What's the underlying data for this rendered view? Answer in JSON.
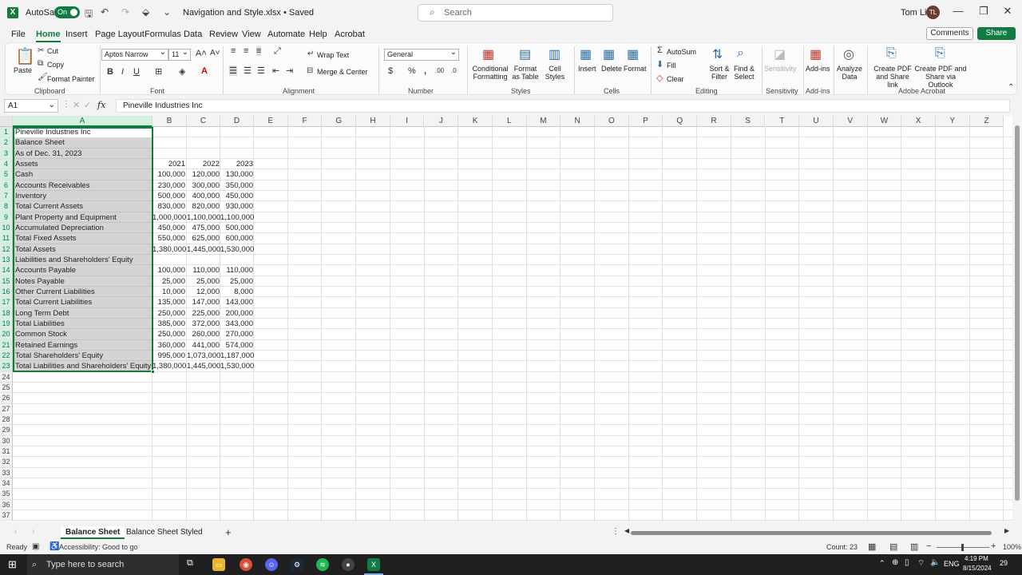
{
  "titlebar": {
    "autosave_label": "AutoSave",
    "autosave_state": "On",
    "doc_title": "Navigation and Style.xlsx • Saved",
    "search_placeholder": "Search",
    "user_name": "Tom Lin",
    "user_initials": "TL"
  },
  "tabs": [
    "File",
    "Home",
    "Insert",
    "Page Layout",
    "Formulas",
    "Data",
    "Review",
    "View",
    "Automate",
    "Help",
    "Acrobat"
  ],
  "active_tab": "Home",
  "comments_label": "Comments",
  "share_label": "Share",
  "ribbon": {
    "clipboard": {
      "paste": "Paste",
      "cut": "Cut",
      "copy": "Copy",
      "format_painter": "Format Painter",
      "label": "Clipboard"
    },
    "font": {
      "name": "Aptos Narrow",
      "size": "11",
      "label": "Font",
      "bold": "B",
      "italic": "I",
      "underline": "U"
    },
    "alignment": {
      "wrap": "Wrap Text",
      "merge": "Merge & Center",
      "label": "Alignment"
    },
    "number": {
      "format": "General",
      "label": "Number",
      "currency": "$",
      "percent": "%"
    },
    "styles": {
      "conditional": "Conditional Formatting",
      "format_table": "Format as Table",
      "cell_styles": "Cell Styles",
      "label": "Styles"
    },
    "cells": {
      "insert": "Insert",
      "delete": "Delete",
      "format": "Format",
      "label": "Cells"
    },
    "editing": {
      "autosum": "AutoSum",
      "fill": "Fill",
      "clear": "Clear",
      "sort": "Sort & Filter",
      "find": "Find & Select",
      "label": "Editing"
    },
    "sensitivity": {
      "btn": "Sensitivity",
      "label": "Sensitivity"
    },
    "addins": {
      "btn": "Add-ins",
      "label": "Add-ins"
    },
    "analyze": {
      "btn": "Analyze Data"
    },
    "acrobat": {
      "pdf_link": "Create PDF and Share link",
      "pdf_outlook": "Create PDF and Share via Outlook",
      "label": "Adobe Acrobat"
    }
  },
  "formula_bar": {
    "cell_ref": "A1",
    "fx": "fx",
    "content": "Pineville Industries Inc"
  },
  "columns": [
    "A",
    "B",
    "C",
    "D",
    "E",
    "F",
    "G",
    "H",
    "I",
    "J",
    "K",
    "L",
    "M",
    "N",
    "O",
    "P",
    "Q",
    "R",
    "S",
    "T",
    "U",
    "V",
    "W",
    "X",
    "Y",
    "Z"
  ],
  "rows": [
    {
      "a": "Pineville Industries Inc",
      "b": "",
      "c": "",
      "d": ""
    },
    {
      "a": "Balance Sheet",
      "b": "",
      "c": "",
      "d": ""
    },
    {
      "a": "As of Dec. 31, 2023",
      "b": "",
      "c": "",
      "d": ""
    },
    {
      "a": "Assets",
      "b": "2021",
      "c": "2022",
      "d": "2023"
    },
    {
      "a": "Cash",
      "b": "100,000",
      "c": "120,000",
      "d": "130,000"
    },
    {
      "a": "Accounts Receivables",
      "b": "230,000",
      "c": "300,000",
      "d": "350,000"
    },
    {
      "a": "Inventory",
      "b": "500,000",
      "c": "400,000",
      "d": "450,000"
    },
    {
      "a": "Total Current Assets",
      "b": "830,000",
      "c": "820,000",
      "d": "930,000"
    },
    {
      "a": "Plant Property and Equipment",
      "b": "1,000,000",
      "c": "1,100,000",
      "d": "1,100,000"
    },
    {
      "a": "Accumulated Depreciation",
      "b": "450,000",
      "c": "475,000",
      "d": "500,000"
    },
    {
      "a": "Total Fixed Assets",
      "b": "550,000",
      "c": "625,000",
      "d": "600,000"
    },
    {
      "a": "Total Assets",
      "b": "1,380,000",
      "c": "1,445,000",
      "d": "1,530,000"
    },
    {
      "a": "Liabilities and Shareholders' Equity",
      "b": "",
      "c": "",
      "d": ""
    },
    {
      "a": "Accounts Payable",
      "b": "100,000",
      "c": "110,000",
      "d": "110,000"
    },
    {
      "a": "Notes Payable",
      "b": "25,000",
      "c": "25,000",
      "d": "25,000"
    },
    {
      "a": "Other Current  Liabilities",
      "b": "10,000",
      "c": "12,000",
      "d": "8,000"
    },
    {
      "a": "Total Current Liabilities",
      "b": "135,000",
      "c": "147,000",
      "d": "143,000"
    },
    {
      "a": "Long Term Debt",
      "b": "250,000",
      "c": "225,000",
      "d": "200,000"
    },
    {
      "a": "Total Liabilities",
      "b": "385,000",
      "c": "372,000",
      "d": "343,000"
    },
    {
      "a": "Common Stock",
      "b": "250,000",
      "c": "260,000",
      "d": "270,000"
    },
    {
      "a": "Retained Earnings",
      "b": "360,000",
      "c": "441,000",
      "d": "574,000"
    },
    {
      "a": "Total Shareholders' Equity",
      "b": "995,000",
      "c": "1,073,000",
      "d": "1,187,000"
    },
    {
      "a": "Total Liabilities and Shareholders' Equity",
      "b": "1,380,000",
      "c": "1,445,000",
      "d": "1,530,000"
    }
  ],
  "row_count": 37,
  "sheets": [
    "Balance Sheet",
    "Balance Sheet Styled"
  ],
  "active_sheet": "Balance Sheet",
  "status": {
    "ready": "Ready",
    "accessibility": "Accessibility: Good to go",
    "count": "Count: 23",
    "zoom": "100%"
  },
  "taskbar": {
    "search": "Type here to search",
    "lang": "ENG",
    "time": "4:19 PM",
    "date": "8/15/2024",
    "notif": "29"
  },
  "colors": {
    "accent": "#107c41",
    "selection": "#a0a0a0"
  }
}
